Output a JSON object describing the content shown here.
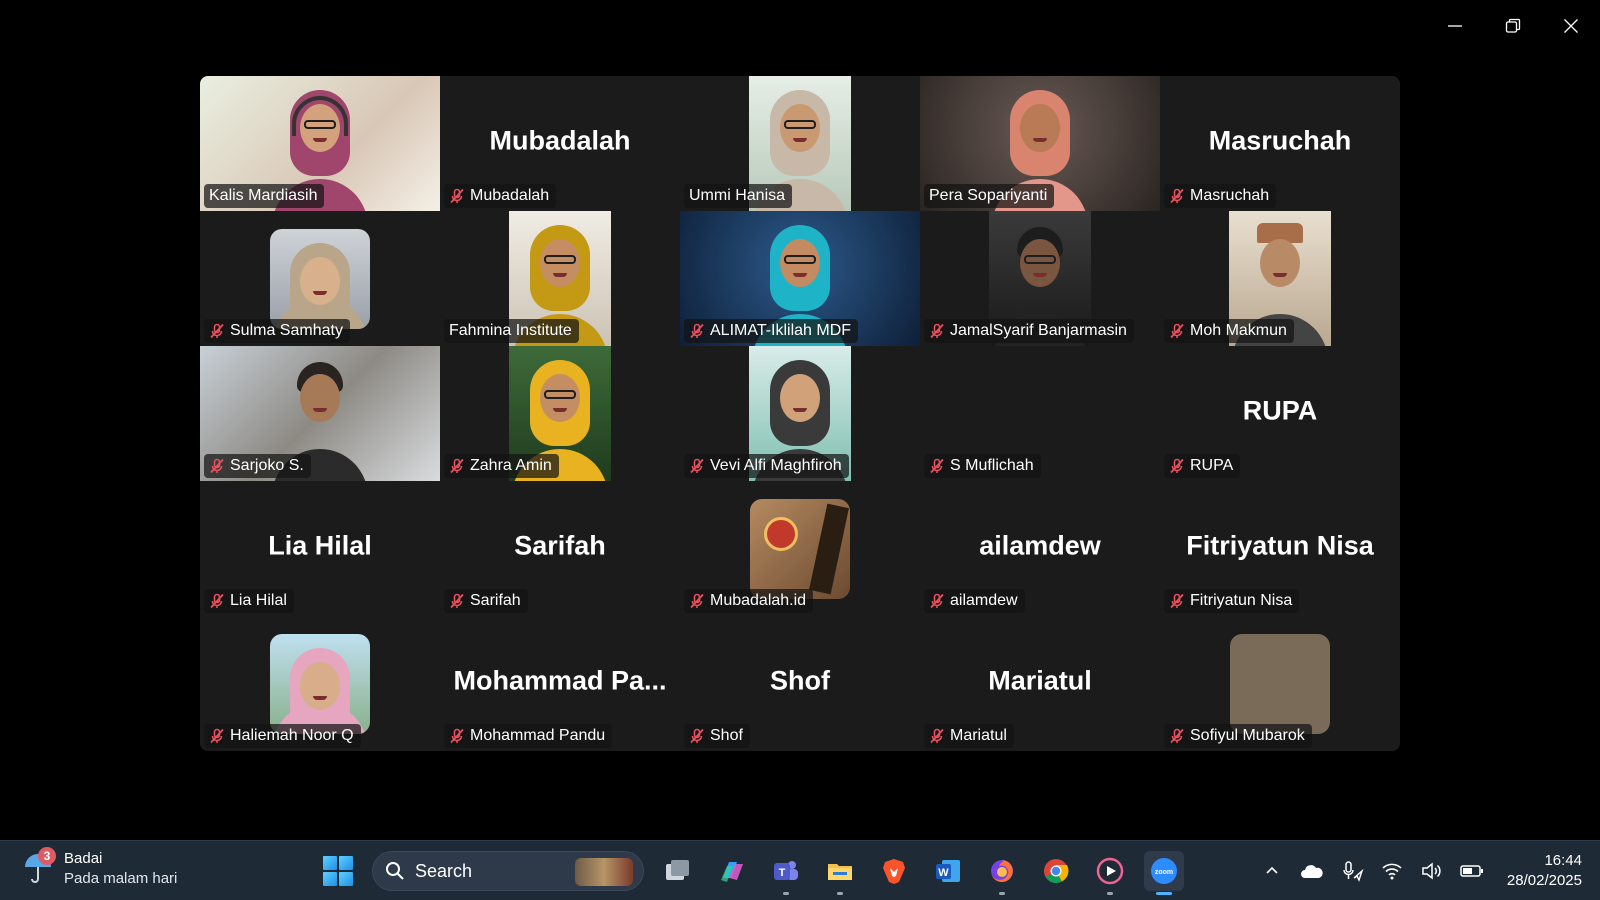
{
  "window": {
    "controls": [
      "minimize",
      "restore",
      "close"
    ]
  },
  "gallery": {
    "tiles": [
      {
        "name": "Kalis Mardiasih",
        "big": "",
        "muted": false,
        "video": "kalis",
        "speaking": false
      },
      {
        "name": "Mubadalah",
        "big": "Mubadalah",
        "muted": true,
        "video": "",
        "speaking": false
      },
      {
        "name": "Ummi Hanisa",
        "big": "",
        "muted": false,
        "video": "ummi",
        "speaking": false
      },
      {
        "name": "Pera Sopariyanti",
        "big": "",
        "muted": false,
        "video": "pera",
        "speaking": true
      },
      {
        "name": "Masruchah",
        "big": "Masruchah",
        "muted": true,
        "video": "",
        "speaking": false
      },
      {
        "name": "Sulma Samhaty",
        "big": "",
        "muted": true,
        "video": "sulma",
        "speaking": false
      },
      {
        "name": "Fahmina Institute",
        "big": "",
        "muted": false,
        "video": "fahmina",
        "speaking": false
      },
      {
        "name": "ALIMAT-Iklilah MDF",
        "big": "",
        "muted": true,
        "video": "alimat",
        "speaking": false
      },
      {
        "name": "JamalSyarif Banjarmasin",
        "big": "",
        "muted": true,
        "video": "jamal",
        "speaking": false
      },
      {
        "name": "Moh Makmun",
        "big": "",
        "muted": true,
        "video": "makmun",
        "speaking": false
      },
      {
        "name": "Sarjoko S.",
        "big": "",
        "muted": true,
        "video": "sarjoko",
        "speaking": false
      },
      {
        "name": "Zahra Amin",
        "big": "",
        "muted": true,
        "video": "zahra",
        "speaking": false
      },
      {
        "name": "Vevi Alfi Maghfiroh",
        "big": "",
        "muted": true,
        "video": "vevi",
        "speaking": false
      },
      {
        "name": "S Muflichah",
        "big": "",
        "muted": true,
        "video": "",
        "speaking": false
      },
      {
        "name": "RUPA",
        "big": "RUPA",
        "muted": true,
        "video": "",
        "speaking": false
      },
      {
        "name": "Lia Hilal",
        "big": "Lia Hilal",
        "muted": true,
        "video": "",
        "speaking": false
      },
      {
        "name": "Sarifah",
        "big": "Sarifah",
        "muted": true,
        "video": "",
        "speaking": false
      },
      {
        "name": "Mubadalah.id",
        "big": "",
        "muted": true,
        "video": "mubadalahid",
        "speaking": false
      },
      {
        "name": "ailamdew",
        "big": "ailamdew",
        "muted": true,
        "video": "",
        "speaking": false
      },
      {
        "name": "Fitriyatun Nisa",
        "big": "Fitriyatun Nisa",
        "muted": true,
        "video": "",
        "speaking": false
      },
      {
        "name": "Haliemah Noor Q",
        "big": "",
        "muted": true,
        "video": "haliemah",
        "speaking": false
      },
      {
        "name": "Mohammad Pandu",
        "big": "Mohammad  Pa...",
        "muted": true,
        "video": "",
        "speaking": false
      },
      {
        "name": "Shof",
        "big": "Shof",
        "muted": true,
        "video": "",
        "speaking": false
      },
      {
        "name": "Mariatul",
        "big": "Mariatul",
        "muted": true,
        "video": "",
        "speaking": false
      },
      {
        "name": "Sofiyul Mubarok",
        "big": "",
        "muted": true,
        "video": "sofiyul",
        "speaking": false
      }
    ]
  },
  "colors": {
    "speaking_border": "#23d18b",
    "muted_icon": "#e8505b",
    "tile_bg": "#1b1b1b"
  },
  "taskbar": {
    "weather": {
      "badge": "3",
      "title": "Badai",
      "subtitle": "Pada malam hari"
    },
    "search": {
      "placeholder": "Search"
    },
    "apps": [
      "task-view",
      "copilot",
      "teams",
      "file-explorer",
      "brave",
      "word",
      "firefox",
      "chrome",
      "media-player",
      "zoom"
    ],
    "clock": {
      "time": "16:44",
      "date": "28/02/2025"
    }
  }
}
